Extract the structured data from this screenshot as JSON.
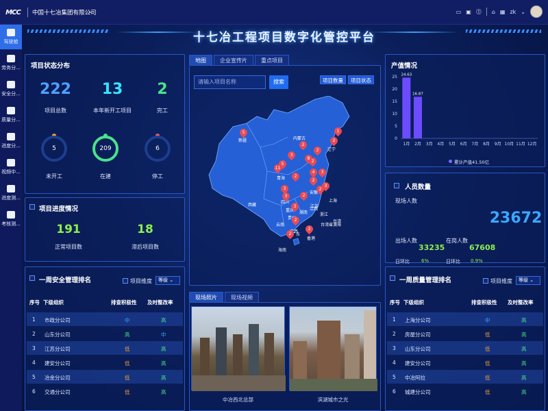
{
  "header": {
    "logo": "MCC",
    "company": "中国十七冶集团有限公司",
    "user": "zk"
  },
  "sidebar": {
    "items": [
      {
        "label": "驾驶舱",
        "active": true
      },
      {
        "label": "劳务分..."
      },
      {
        "label": "安全分..."
      },
      {
        "label": "质量分..."
      },
      {
        "label": "进度分..."
      },
      {
        "label": "视频中..."
      },
      {
        "label": "进度测..."
      },
      {
        "label": "考核测..."
      }
    ]
  },
  "page_title": "十七冶工程项目数字化管控平台",
  "project_status": {
    "title": "项目状态分布",
    "total": {
      "value": "222",
      "label": "项目总数"
    },
    "new": {
      "value": "13",
      "label": "本年新开工项目"
    },
    "done": {
      "value": "2",
      "label": "完工"
    },
    "not_started": {
      "value": "5",
      "label": "未开工"
    },
    "in_progress": {
      "value": "209",
      "label": "在建"
    },
    "stopped": {
      "value": "6",
      "label": "停工"
    }
  },
  "progress": {
    "title": "项目进度情况",
    "normal": {
      "value": "191",
      "label": "正常项目数"
    },
    "late": {
      "value": "18",
      "label": "滞后项目数"
    }
  },
  "safety": {
    "title": "一周安全管理排名",
    "dim_label": "项目维度",
    "sel": "等级",
    "headers": [
      "序号",
      "下级组织",
      "排查积极性",
      "及时整改率"
    ],
    "rows": [
      [
        "1",
        "市政分公司",
        "中",
        "高"
      ],
      [
        "2",
        "山东分公司",
        "高",
        "中"
      ],
      [
        "3",
        "江苏分公司",
        "低",
        "高"
      ],
      [
        "4",
        "建安分公司",
        "低",
        "高"
      ],
      [
        "5",
        "冶金分公司",
        "低",
        "高"
      ],
      [
        "6",
        "交通分公司",
        "低",
        "高"
      ]
    ]
  },
  "map": {
    "tabs": [
      "地图",
      "企业宣传片",
      "重点项目"
    ],
    "search_placeholder": "请输入项目名称",
    "search_btn": "搜索",
    "btn_count": "项目数量",
    "btn_status": "项目状态",
    "provinces": [
      "新疆",
      "内蒙古",
      "辽宁",
      "青海",
      "四川",
      "重庆",
      "贵州",
      "云南",
      "广西",
      "广东",
      "香港",
      "湖南",
      "江西",
      "浙江",
      "台湾",
      "台湾省澳海",
      "海南",
      "西藏",
      "安徽",
      "江苏",
      "上海"
    ],
    "pins": [
      "5",
      "1",
      "2",
      "2",
      "3",
      "8",
      "2",
      "2",
      "5",
      "11",
      "2",
      "3",
      "3",
      "3",
      "2",
      "2",
      "3",
      "2",
      "2",
      "2",
      "2",
      "4",
      "3"
    ]
  },
  "photos": {
    "tabs": [
      "现场照片",
      "现场视频"
    ],
    "captions": [
      "中冶西北总部",
      "滨湖城市之光"
    ]
  },
  "production": {
    "title": "产值情况",
    "legend": "累计产值41.50亿"
  },
  "chart_data": {
    "type": "bar",
    "categories": [
      "1月",
      "2月",
      "3月",
      "4月",
      "5月",
      "6月",
      "7月",
      "8月",
      "9月",
      "10月",
      "11月",
      "12月"
    ],
    "values": [
      24.63,
      16.87,
      0,
      0,
      0,
      0,
      0,
      0,
      0,
      0,
      0,
      0
    ],
    "labels": [
      "24.63",
      "16.87"
    ],
    "ylim": [
      0,
      25
    ],
    "yticks": [
      "0",
      "5",
      "10",
      "15",
      "20",
      "25"
    ]
  },
  "people": {
    "title": "人员数量",
    "onsite_label": "现场人数",
    "onsite": "23672",
    "exit_label": "出场人数",
    "exit": "33235",
    "in_label": "在岗人数",
    "in": "67608",
    "ratio_label1": "日环比",
    "ratio1": "6%",
    "ratio_label2": "日环比",
    "ratio2": "0.9%"
  },
  "quality": {
    "title": "一周质量管理排名",
    "dim_label": "项目维度",
    "sel": "等级",
    "headers": [
      "序号",
      "下级组织",
      "排查积极性",
      "及时整改率"
    ],
    "rows": [
      [
        "1",
        "上海分公司",
        "中",
        "高"
      ],
      [
        "2",
        "房屋分公司",
        "低",
        "高"
      ],
      [
        "3",
        "山东分公司",
        "低",
        "高"
      ],
      [
        "4",
        "建安分公司",
        "低",
        "高"
      ],
      [
        "5",
        "中冶阿拉",
        "低",
        "高"
      ],
      [
        "6",
        "城建分公司",
        "低",
        "高"
      ]
    ]
  }
}
